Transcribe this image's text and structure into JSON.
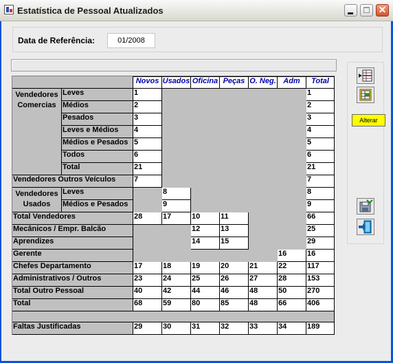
{
  "window": {
    "title": "Estatística de Pessoal Atualizados"
  },
  "ref": {
    "label": "Data de Referência:",
    "value": "01/2008"
  },
  "toolbar": {
    "alterar": "Alterar"
  },
  "table": {
    "headers": [
      "Novos",
      "Usados",
      "Oficina",
      "Peças",
      "O. Neg.",
      "Adm",
      "Total"
    ],
    "groups": {
      "comerciais": "Vendedores Comercias",
      "usados": "Vendedores Usados"
    },
    "rows": {
      "leves": {
        "label": "Leves",
        "novos": "1",
        "total": "1"
      },
      "medios": {
        "label": "Médios",
        "novos": "2",
        "total": "2"
      },
      "pesados": {
        "label": "Pesados",
        "novos": "3",
        "total": "3"
      },
      "leves_medios": {
        "label": "Leves e Médios",
        "novos": "4",
        "total": "4"
      },
      "medios_pesados": {
        "label": "Médios e Pesados",
        "novos": "5",
        "total": "5"
      },
      "todos": {
        "label": "Todos",
        "novos": "6",
        "total": "6"
      },
      "total_com": {
        "label": "Total",
        "novos": "21",
        "total": "21"
      },
      "outros_veic": {
        "label": "Vendedores  Outros Veículos",
        "novos": "7",
        "total": "7"
      },
      "usados_leves": {
        "label": "Leves",
        "usados": "8",
        "total": "8"
      },
      "usados_mp": {
        "label": "Médios e Pesados",
        "usados": "9",
        "total": "9"
      },
      "total_vend": {
        "label": "Total Vendedores",
        "novos": "28",
        "usados": "17",
        "oficina": "10",
        "pecas": "11",
        "total": "66"
      },
      "mecanicos": {
        "label": "Mecânicos / Empr. Balcão",
        "oficina": "12",
        "pecas": "13",
        "total": "25"
      },
      "aprendizes": {
        "label": "Aprendizes",
        "oficina": "14",
        "pecas": "15",
        "total": "29"
      },
      "gerente": {
        "label": "Gerente",
        "adm": "16",
        "total": "16"
      },
      "chefes": {
        "label": "Chefes Departamento",
        "novos": "17",
        "usados": "18",
        "oficina": "19",
        "pecas": "20",
        "oneg": "21",
        "adm": "22",
        "total": "117"
      },
      "administrativos": {
        "label": "Administrativos / Outros",
        "novos": "23",
        "usados": "24",
        "oficina": "25",
        "pecas": "26",
        "oneg": "27",
        "adm": "28",
        "total": "153"
      },
      "outro_pessoal": {
        "label": "Total Outro Pessoal",
        "novos": "40",
        "usados": "42",
        "oficina": "44",
        "pecas": "46",
        "oneg": "48",
        "adm": "50",
        "total": "270"
      },
      "total": {
        "label": "Total",
        "novos": "68",
        "usados": "59",
        "oficina": "80",
        "pecas": "85",
        "oneg": "48",
        "adm": "66",
        "total": "406"
      },
      "faltas": {
        "label": "Faltas Justificadas",
        "novos": "29",
        "usados": "30",
        "oficina": "31",
        "pecas": "32",
        "oneg": "33",
        "adm": "34",
        "total": "189"
      }
    }
  }
}
